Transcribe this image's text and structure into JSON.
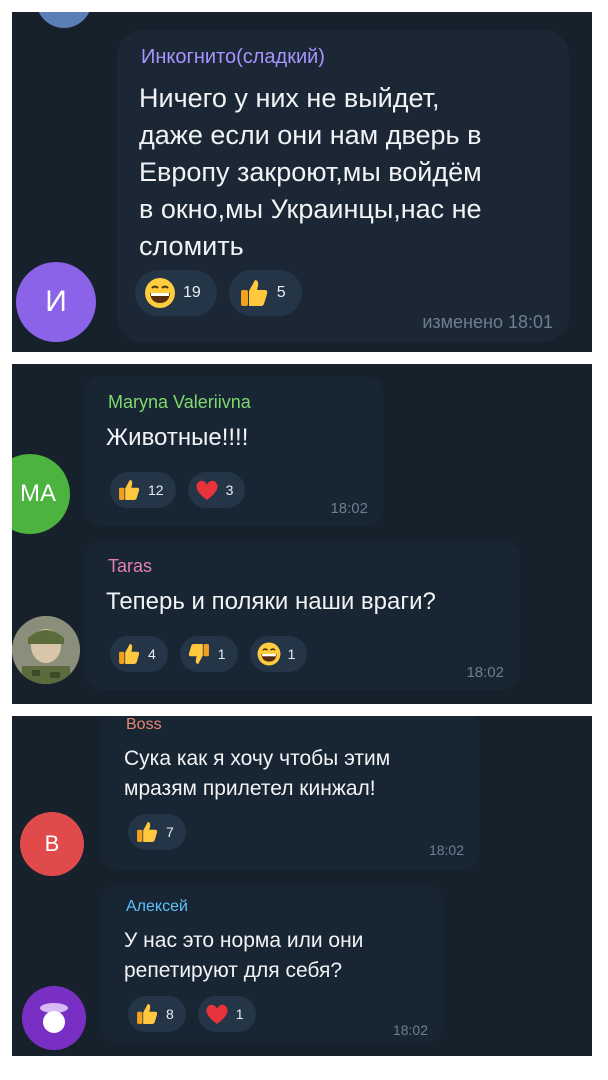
{
  "messages": [
    {
      "author": "Инкогнито(сладкий)",
      "lines": [
        "Ничего у них не выйдет,",
        "даже если они нам дверь в",
        "Европу закроют,мы войдём",
        "в окно,мы Украинцы,нас не",
        "сломить"
      ],
      "avatar_letter": "И",
      "reactions": [
        {
          "emoji": "grin",
          "count": "19"
        },
        {
          "emoji": "thumbs-up",
          "count": "5"
        }
      ],
      "time": "изменено 18:01"
    },
    {
      "author": "Maryna Valeriivna",
      "lines": [
        "Животные!!!!"
      ],
      "avatar_letter": "МА",
      "reactions": [
        {
          "emoji": "thumbs-up",
          "count": "12"
        },
        {
          "emoji": "heart",
          "count": "3"
        }
      ],
      "time": "18:02"
    },
    {
      "author": "Taras",
      "lines": [
        "Теперь и поляки наши враги?"
      ],
      "avatar_letter": "",
      "reactions": [
        {
          "emoji": "thumbs-up",
          "count": "4"
        },
        {
          "emoji": "thumbs-down",
          "count": "1"
        },
        {
          "emoji": "grin",
          "count": "1"
        }
      ],
      "time": "18:02"
    },
    {
      "author": "Boss",
      "lines": [
        "Сука как я хочу чтобы этим",
        "мразям прилетел кинжал!"
      ],
      "avatar_letter": "B",
      "reactions": [
        {
          "emoji": "thumbs-up",
          "count": "7"
        }
      ],
      "time": "18:02"
    },
    {
      "author": "Алексей",
      "lines": [
        "У нас это норма или они",
        "репетируют для себя?"
      ],
      "avatar_letter": "",
      "reactions": [
        {
          "emoji": "thumbs-up",
          "count": "8"
        },
        {
          "emoji": "heart",
          "count": "1"
        }
      ],
      "time": "18:02"
    }
  ],
  "colors": {
    "background": "#17212b",
    "bubble": "#182533",
    "reaction_pill": "#243547",
    "time": "#6d7f8f",
    "name_incognito": "#a894ff",
    "name_maryna": "#7fd86f",
    "name_taras": "#e67fb1",
    "name_boss": "#e9856f",
    "name_aleksey": "#5fc0ff",
    "avatar_purple": "#8a63e8",
    "avatar_green": "#4bb33e",
    "avatar_red": "#e14a4a",
    "avatar_violet": "#7a2fc4"
  }
}
